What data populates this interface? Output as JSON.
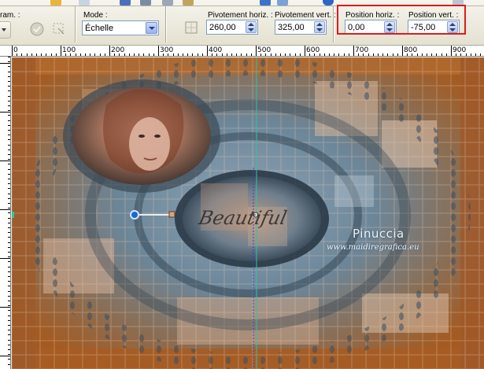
{
  "toolbar": {
    "left_label_partial": "ram. :",
    "mode": {
      "label": "Mode :",
      "value": "Échelle"
    },
    "pivot_h": {
      "label": "Pivotement horiz. :",
      "value": "260,00"
    },
    "pivot_v": {
      "label": "Pivotement vert. :",
      "value": "325,00"
    },
    "pos_h": {
      "label": "Position horiz. :",
      "value": "0,00"
    },
    "pos_v": {
      "label": "Position vert. :",
      "value": "-75,00"
    }
  },
  "ruler": {
    "labels": [
      "0",
      "100",
      "200",
      "300",
      "400",
      "500",
      "600",
      "700",
      "800",
      "900"
    ]
  },
  "canvas": {
    "watermark_name": "Pinuccia",
    "watermark_url": "www.maidiregrafica.eu",
    "center_text": "Beautiful"
  },
  "colors": {
    "highlight": "#e11a1a",
    "canvas_orange": "#a9612a",
    "canvas_steel": "#5f7b90"
  }
}
